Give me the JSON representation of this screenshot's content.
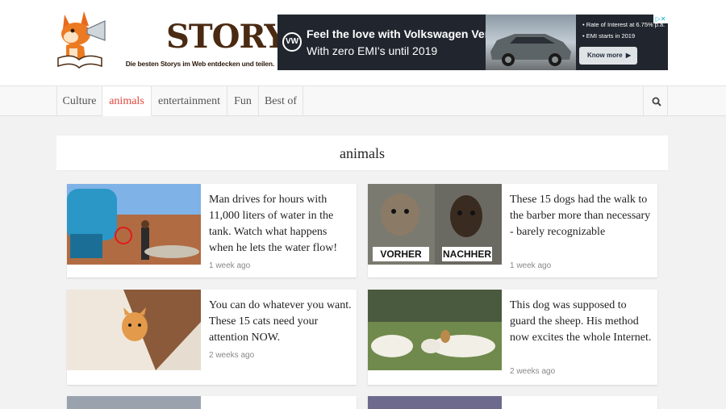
{
  "site": {
    "name": "STORYFOX",
    "tagline": "Die besten Storys im Web entdecken und teilen."
  },
  "ad": {
    "brand": "VW",
    "headline": "Feel the love with Volkswagen Vento.",
    "subline": "With zero EMI's until 2019",
    "info_1": "• Rate of Interest at 6.75% p.a.",
    "info_2": "• EMI starts in 2019",
    "button": "Know more",
    "close": "▷✕"
  },
  "nav": {
    "items": [
      "Culture",
      "animals",
      "entertainment",
      "Fun",
      "Best of"
    ],
    "active": "animals"
  },
  "section": {
    "title": "animals"
  },
  "articles": [
    {
      "title": "Man drives for hours with 11,000 liters of water in the tank. Watch what happens when he lets the water flow!",
      "time": "1 week ago"
    },
    {
      "title": "These 15 dogs had the walk to the barber more than necessary - barely recognizable",
      "time": "1 week ago",
      "label_left": "VORHER",
      "label_right": "NACHHER"
    },
    {
      "title": "You can do whatever you want. These 15 cats need your attention NOW.",
      "time": "2 weeks ago"
    },
    {
      "title": "This dog was supposed to guard the sheep. His method now excites the whole Internet.",
      "time": "2 weeks ago"
    }
  ],
  "colors": {
    "accent": "#e0473d",
    "brand": "#4a2a12",
    "ad_bg": "#21262e"
  }
}
